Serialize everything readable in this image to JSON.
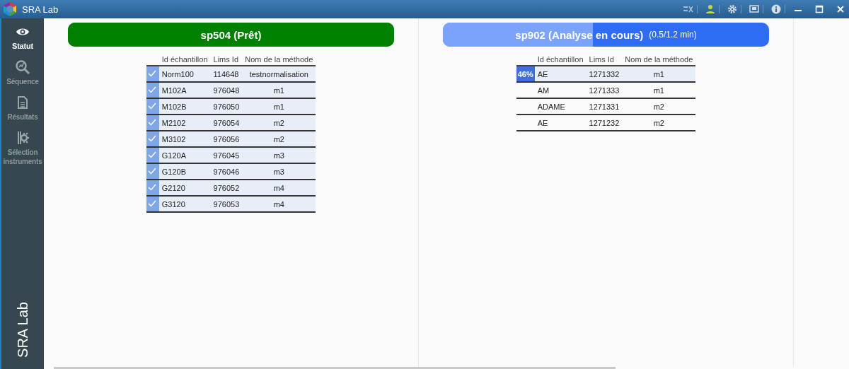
{
  "window": {
    "title": "SRA Lab"
  },
  "sidebar": {
    "items": [
      {
        "label": "Statut",
        "selected": true
      },
      {
        "label": "Séquence",
        "selected": false
      },
      {
        "label": "Résultats",
        "selected": false
      },
      {
        "label": "Sélection instruments",
        "selected": false
      }
    ],
    "footer": "SRA Lab"
  },
  "instruments": [
    {
      "title": "sp504 (Prêt)",
      "running": false,
      "level": 1,
      "columns": [
        "Id échantillon",
        "Lims Id",
        "Nom de la méthode"
      ],
      "rows": [
        {
          "checked": true,
          "cells": [
            "Norm100",
            "114648",
            "testnormalisation"
          ]
        },
        {
          "checked": true,
          "cells": [
            "M102A",
            "976048",
            "m1"
          ]
        },
        {
          "checked": true,
          "cells": [
            "M102B",
            "976050",
            "m1"
          ]
        },
        {
          "checked": true,
          "cells": [
            "M2102",
            "976054",
            "m2"
          ]
        },
        {
          "checked": true,
          "cells": [
            "M3102",
            "976056",
            "m2"
          ]
        },
        {
          "checked": true,
          "cells": [
            "G120A",
            "976045",
            "m3"
          ]
        },
        {
          "checked": true,
          "cells": [
            "G120B",
            "976046",
            "m3"
          ]
        },
        {
          "checked": true,
          "cells": [
            "G2120",
            "976052",
            "m4"
          ]
        },
        {
          "checked": true,
          "cells": [
            "G3120",
            "976053",
            "m4"
          ]
        }
      ]
    },
    {
      "title": "sp902 (Analyse en cours)",
      "detail": "(0.5/1.2 min)",
      "running": true,
      "level": 0.46,
      "columns": [
        "Id échantillon",
        "Lims Id",
        "Nom de la méthode"
      ],
      "rows": [
        {
          "checked": false,
          "progress": "46%",
          "cells": [
            "AE",
            "1271332",
            "m1"
          ]
        },
        {
          "checked": false,
          "cells": [
            "AM",
            "1271333",
            "m1"
          ]
        },
        {
          "checked": false,
          "cells": [
            "ADAME",
            "1271331",
            "m2"
          ]
        },
        {
          "checked": false,
          "cells": [
            "AE",
            "1271232",
            "m2"
          ]
        }
      ]
    }
  ]
}
